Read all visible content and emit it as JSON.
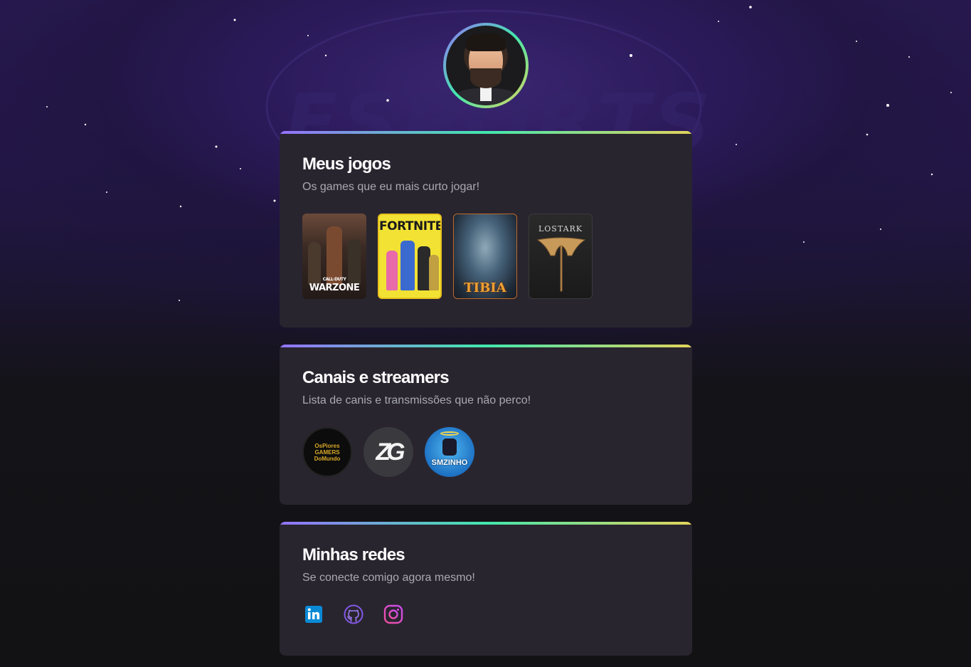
{
  "profile": {
    "avatar": "profile-photo"
  },
  "cards": {
    "games": {
      "title": "Meus jogos",
      "subtitle": "Os games que eu mais curto jogar!",
      "items": [
        {
          "name": "Call of Duty Warzone",
          "label": "WARZONE",
          "sub": "CALL·DUTY"
        },
        {
          "name": "Fortnite",
          "label": "FORTNITE"
        },
        {
          "name": "Tibia",
          "label": "TIBIA"
        },
        {
          "name": "Lost Ark",
          "label": "LOSTARK"
        }
      ]
    },
    "channels": {
      "title": "Canais e streamers",
      "subtitle": "Lista de canis e transmissões que não perco!",
      "items": [
        {
          "name": "Os Piores Gamers do Mundo",
          "label": "OsPiores GAMERS DoMundo"
        },
        {
          "name": "ZG",
          "label": "ZG"
        },
        {
          "name": "Smzinho",
          "label": "SMZINHO"
        }
      ]
    },
    "socials": {
      "title": "Minhas redes",
      "subtitle": "Se conecte comigo agora mesmo!",
      "items": [
        {
          "name": "linkedin",
          "icon": "linkedin-icon",
          "color": "#0a66c2"
        },
        {
          "name": "github",
          "icon": "github-icon",
          "color": "#8257e5"
        },
        {
          "name": "instagram",
          "icon": "instagram-icon",
          "color": "#e1306c"
        }
      ]
    }
  },
  "colors": {
    "background": "#121214",
    "card": "#29252f",
    "gradient": [
      "#9572fc",
      "#43e7ad",
      "#e2d45c"
    ],
    "title": "#ffffff",
    "subtitle": "#a9a9b2"
  }
}
